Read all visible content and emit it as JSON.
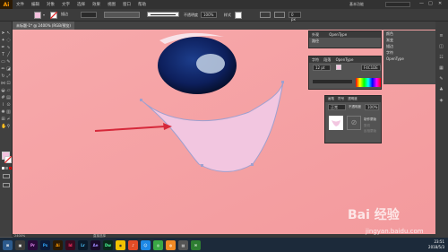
{
  "app": {
    "logo": "Ai",
    "menus": [
      "文件",
      "编辑",
      "对象",
      "文字",
      "选择",
      "效果",
      "视图",
      "窗口",
      "帮助"
    ],
    "workspace": "基本功能",
    "colors": {
      "accent": "#ff9a00",
      "canvas": "#f5a3a5",
      "shape_fill": "#f2c6e0",
      "shape_stroke": "#9fa0cf"
    }
  },
  "control_bar": {
    "stroke_label": "描边",
    "stroke_weight": "",
    "opacity_label": "不透明度",
    "opacity_value": "100%",
    "style_label": "样式",
    "width_value": "0 px"
  },
  "document": {
    "tab_title": "未标题-1* @ 2400% (RGB/预览)"
  },
  "status": {
    "zoom": "2400%",
    "mode": "直接选择"
  },
  "panels": {
    "appearance": {
      "tabs": [
        "外观",
        "OpenType"
      ],
      "row1": "路径",
      "row2": "描边",
      "row3": "填色"
    },
    "character": {
      "tabs": [
        "字符",
        "段落",
        "OpenType"
      ],
      "size": "12 pt",
      "hex": "F4C1DE"
    },
    "swatches": {
      "tabs": [
        "画笔",
        "符号",
        "透明度"
      ],
      "mode": "正常",
      "opacity_label": "不透明度",
      "opacity": "100%",
      "btn_make_mask": "制作蒙版",
      "chk_clip": "剪切",
      "chk_invert": "反相蒙版"
    },
    "right_labels": [
      "颜色",
      "渐变",
      "描边",
      "字符",
      "OpenType"
    ]
  },
  "taskbar": {
    "time": "23:51",
    "date": "2018/5/3",
    "icons": [
      "Pr",
      "Ps",
      "Ai",
      "Id",
      "Lr",
      "Ae",
      "Dw"
    ]
  },
  "watermark": {
    "line1": "Bai 经验",
    "line2": "jingyan.baidu.com"
  }
}
